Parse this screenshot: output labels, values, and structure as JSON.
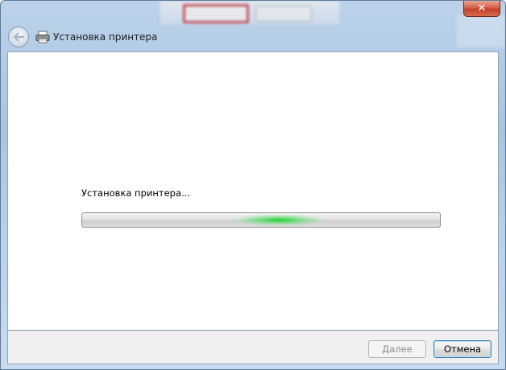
{
  "window": {
    "close_glyph": "✕"
  },
  "nav": {
    "title": "Установка принтера",
    "back_icon": "back-arrow-icon",
    "title_icon": "printer-icon"
  },
  "main": {
    "status_text": "Установка принтера...",
    "progress": {
      "mode": "indeterminate",
      "glow_position_percent": 55,
      "glow_color": "#14d228"
    }
  },
  "footer": {
    "next_label": "Далее",
    "next_enabled": false,
    "cancel_label": "Отмена"
  },
  "colors": {
    "title_bar": "#a9c4e2",
    "content_bg": "#ffffff",
    "footer_bg": "#f0f0f0",
    "close_button": "#c4402a",
    "default_button_border": "#3c7fb1"
  }
}
